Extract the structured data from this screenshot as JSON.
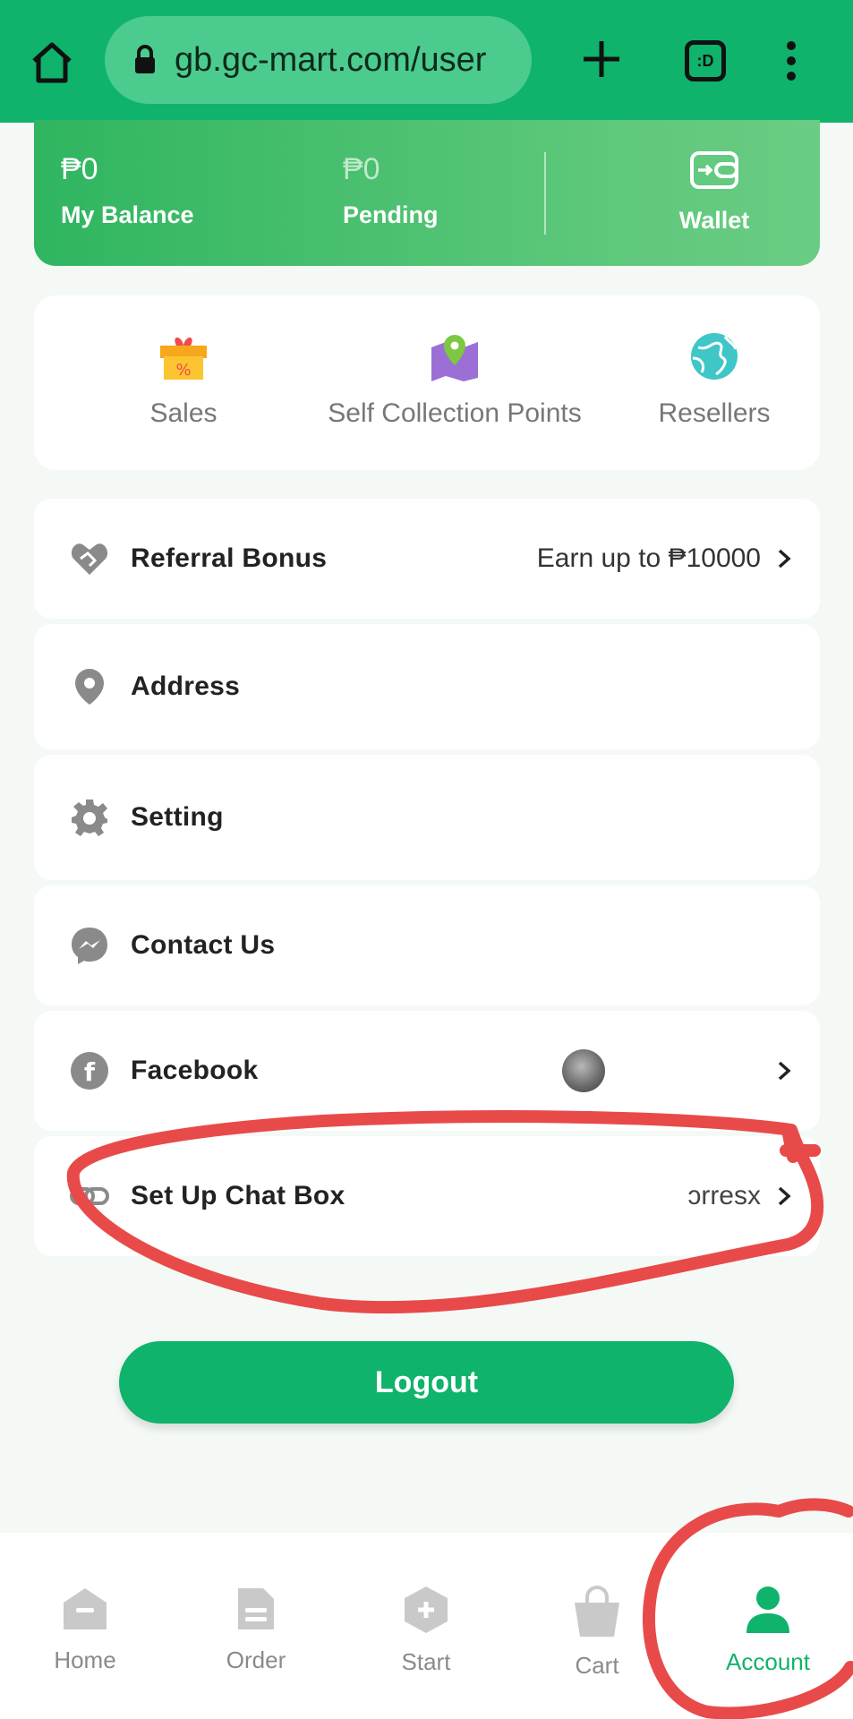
{
  "browser": {
    "url": "gb.gc-mart.com/user",
    "tabs_label": ":D"
  },
  "balance": {
    "my_balance_value": "₱0",
    "my_balance_label": "My Balance",
    "pending_value": "₱0",
    "pending_label": "Pending",
    "wallet_label": "Wallet"
  },
  "quick": [
    {
      "label": "Sales",
      "icon": "gift-percent-icon"
    },
    {
      "label": "Self Collection Points",
      "icon": "map-pin-icon"
    },
    {
      "label": "Resellers",
      "icon": "globe-icon"
    }
  ],
  "menu": {
    "referral": {
      "label": "Referral Bonus",
      "value": "Earn up to ₱10000"
    },
    "address": {
      "label": "Address"
    },
    "setting": {
      "label": "Setting"
    },
    "contact": {
      "label": "Contact Us"
    },
    "facebook": {
      "label": "Facebook"
    },
    "chatbox": {
      "label": "Set Up Chat Box",
      "value": "ɔrresx"
    }
  },
  "logout_label": "Logout",
  "nav": [
    {
      "label": "Home",
      "icon": "home-icon"
    },
    {
      "label": "Order",
      "icon": "order-icon"
    },
    {
      "label": "Start",
      "icon": "start-icon"
    },
    {
      "label": "Cart",
      "icon": "cart-icon"
    },
    {
      "label": "Account",
      "icon": "account-icon",
      "active": true
    }
  ],
  "colors": {
    "brand": "#0fb36b",
    "annotation": "#e84a4a"
  }
}
